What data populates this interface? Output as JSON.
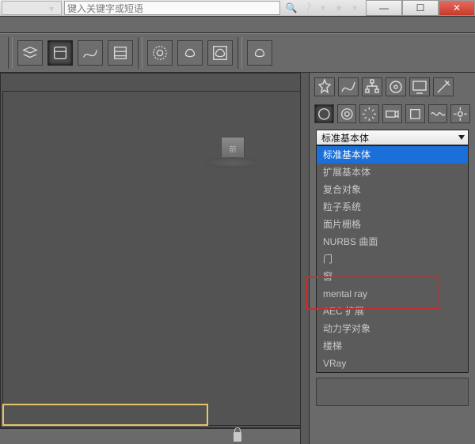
{
  "search": {
    "placeholder": "键入关键字或短语"
  },
  "window_buttons": {
    "min": "—",
    "max": "☐",
    "close": "✕"
  },
  "toolbar_icons": [
    "layers-icon",
    "layer-manager-icon",
    "curve-editor-icon",
    "dope-sheet-icon",
    "schematic-icon",
    "material-icon",
    "material-browser-icon",
    "render-setup-icon",
    "render-icon"
  ],
  "cmd_tabs": [
    "create",
    "modify",
    "hierarchy",
    "motion",
    "display",
    "utilities"
  ],
  "cmd_subtabs": [
    "geometry",
    "shapes",
    "lights",
    "cameras",
    "helpers",
    "spacewarps",
    "systems"
  ],
  "viewport_label": "前",
  "dropdown": {
    "selected": "标准基本体",
    "options": [
      "标准基本体",
      "扩展基本体",
      "复合对象",
      "粒子系统",
      "面片栅格",
      "NURBS 曲面",
      "门",
      "窗",
      "mental ray",
      "AEC 扩展",
      "动力学对象",
      "楼梯",
      "VRay"
    ]
  },
  "rollout_placeholder": ""
}
